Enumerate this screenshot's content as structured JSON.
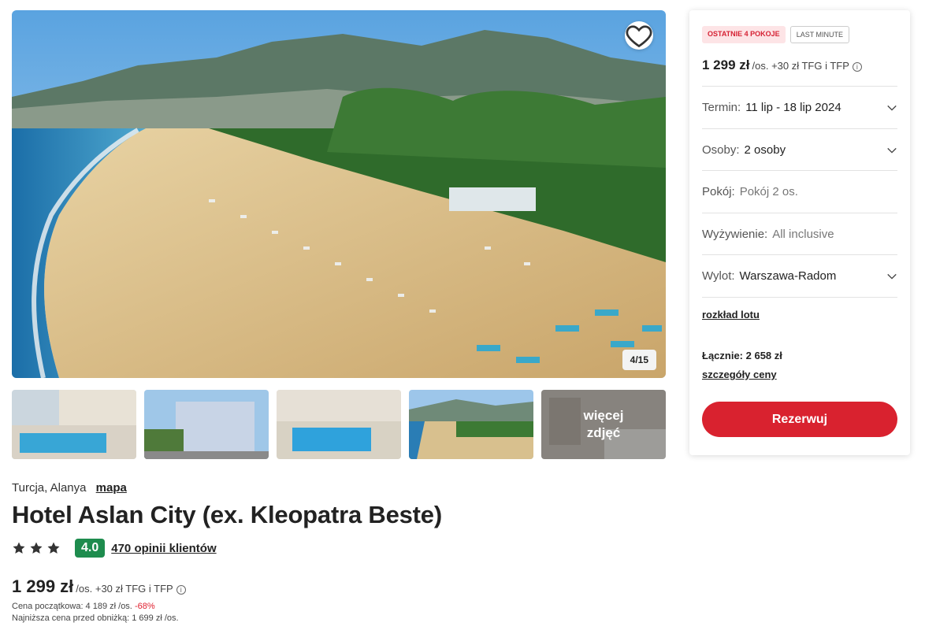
{
  "gallery": {
    "counter": "4/15",
    "more_photos_label": "więcej zdjęć"
  },
  "hotel": {
    "location": "Turcja, Alanya",
    "map_link": "mapa",
    "name": "Hotel Aslan City (ex. Kleopatra Beste)",
    "stars": 3,
    "score": "4.0",
    "reviews_link": "470 opinii klientów"
  },
  "pricing": {
    "amount": "1 299 zł",
    "suffix": "/os. +30 zł TFG i TFP",
    "initial_price_label": "Cena początkowa: 4 189 zł /os.",
    "discount": "-68%",
    "lowest_price_label": "Najniższa cena przed obniżką: 1 699 zł /os."
  },
  "panel": {
    "badges": [
      "OSTATNIE 4 POKOJE",
      "LAST MINUTE"
    ],
    "price_amount": "1 299 zł",
    "price_suffix": "/os. +30 zł TFG i TFP",
    "options": [
      {
        "label": "Termin:",
        "value": "11 lip - 18 lip 2024"
      },
      {
        "label": "Osoby:",
        "value": "2 osoby"
      },
      {
        "label": "Pokój:",
        "value": "Pokój 2 os."
      },
      {
        "label": "Wyżywienie:",
        "value": "All inclusive"
      },
      {
        "label": "Wylot:",
        "value": "Warszawa-Radom"
      }
    ],
    "flight_schedule_link": "rozkład lotu",
    "total": "Łącznie: 2 658 zł",
    "price_details_link": "szczegóły ceny",
    "book_button": "Rezerwuj"
  },
  "colors": {
    "accent_red": "#d9222f",
    "score_green": "#1e8c4e"
  },
  "icons": {
    "favorite": "heart-icon",
    "chevron": "chevron-down-icon",
    "star": "star-icon",
    "info": "info-icon"
  }
}
